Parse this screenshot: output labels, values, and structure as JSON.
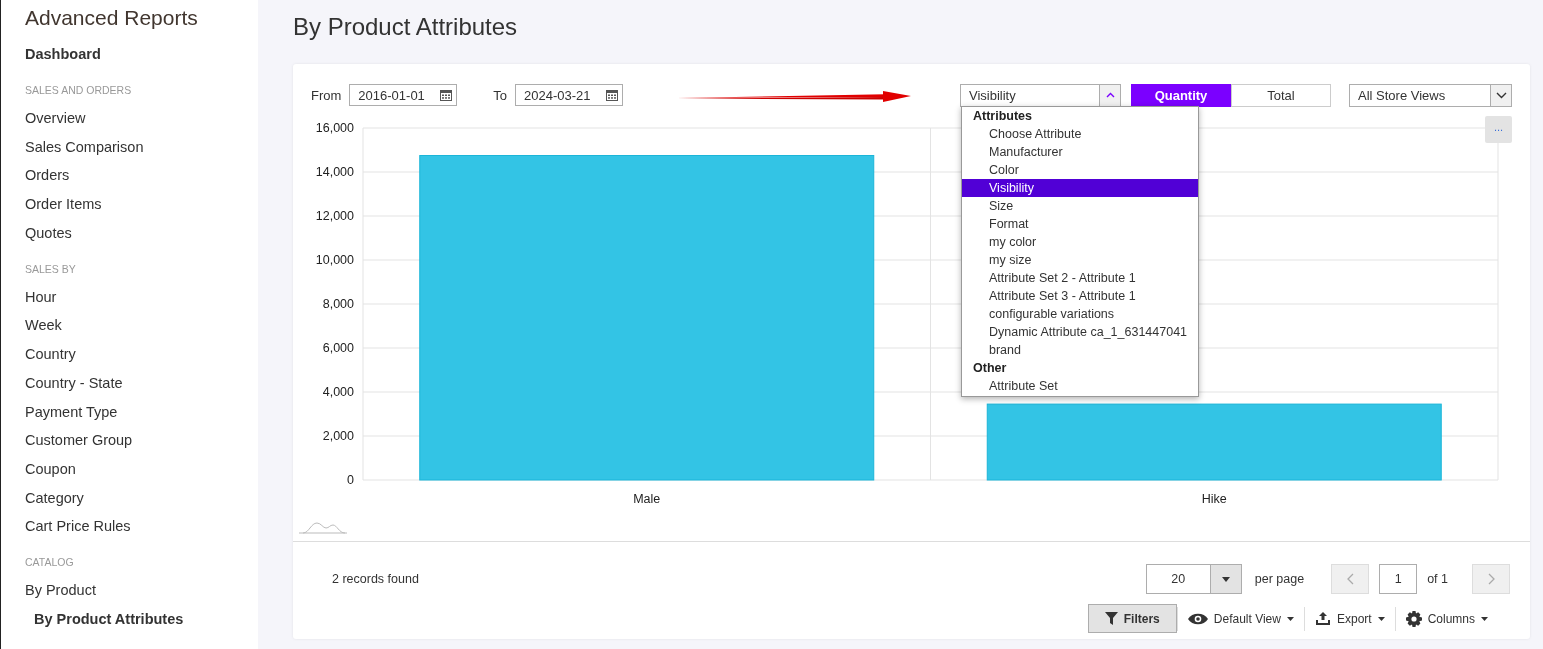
{
  "sidebar": {
    "title": "Advanced Reports",
    "dashboard": {
      "label": "Dashboard",
      "selected": false
    },
    "sections": [
      {
        "heading": "SALES AND ORDERS",
        "items": [
          {
            "label": "Overview",
            "selected": false
          },
          {
            "label": "Sales Comparison",
            "selected": false
          },
          {
            "label": "Orders",
            "selected": false
          },
          {
            "label": "Order Items",
            "selected": false
          },
          {
            "label": "Quotes",
            "selected": false
          }
        ]
      },
      {
        "heading": "SALES BY",
        "items": [
          {
            "label": "Hour",
            "selected": false
          },
          {
            "label": "Week",
            "selected": false
          },
          {
            "label": "Country",
            "selected": false
          },
          {
            "label": "Country - State",
            "selected": false
          },
          {
            "label": "Payment Type",
            "selected": false
          },
          {
            "label": "Customer Group",
            "selected": false
          },
          {
            "label": "Coupon",
            "selected": false
          },
          {
            "label": "Category",
            "selected": false
          },
          {
            "label": "Cart Price Rules",
            "selected": false
          }
        ]
      },
      {
        "heading": "CATALOG",
        "items": [
          {
            "label": "By Product",
            "selected": false,
            "children": [
              {
                "label": "By Product Attributes",
                "selected": true
              }
            ]
          }
        ]
      }
    ]
  },
  "page_title": "By Product Attributes",
  "toolbar": {
    "from_label": "From",
    "from_value": "2016-01-01",
    "to_label": "To",
    "to_value": "2024-03-21",
    "attribute_select": {
      "value": "Visibility",
      "expanded": true
    },
    "metric_toggle": [
      {
        "label": "Quantity",
        "selected": true
      },
      {
        "label": "Total",
        "selected": false
      }
    ],
    "store_select": {
      "value": "All Store Views"
    }
  },
  "attribute_dropdown": [
    {
      "group": "Attributes",
      "options": [
        {
          "label": "Choose Attribute",
          "selected": false
        },
        {
          "label": "Manufacturer",
          "selected": false
        },
        {
          "label": "Color",
          "selected": false
        },
        {
          "label": "Visibility",
          "selected": true
        },
        {
          "label": "Size",
          "selected": false
        },
        {
          "label": "Format",
          "selected": false
        },
        {
          "label": "my color",
          "selected": false
        },
        {
          "label": "my size",
          "selected": false
        },
        {
          "label": "Attribute Set 2 - Attribute 1",
          "selected": false
        },
        {
          "label": "Attribute Set 3 - Attribute 1",
          "selected": false
        },
        {
          "label": "configurable variations",
          "selected": false
        },
        {
          "label": "Dynamic Attribute ca_1_631447041",
          "selected": false
        },
        {
          "label": "brand",
          "selected": false
        }
      ]
    },
    {
      "group": "Other",
      "options": [
        {
          "label": "Attribute Set",
          "selected": false
        }
      ]
    }
  ],
  "chart_menu": "...",
  "chart_data": {
    "type": "bar",
    "grid": true,
    "categories": [
      "Male",
      "Hike"
    ],
    "values": [
      14750,
      3450
    ],
    "ylim": [
      0,
      16000
    ],
    "yticks": [
      {
        "value": 0,
        "label": "0"
      },
      {
        "value": 2000,
        "label": "2,000"
      },
      {
        "value": 4000,
        "label": "4,000"
      },
      {
        "value": 6000,
        "label": "6,000"
      },
      {
        "value": 8000,
        "label": "8,000"
      },
      {
        "value": 10000,
        "label": "10,000"
      },
      {
        "value": 12000,
        "label": "12,000"
      },
      {
        "value": 14000,
        "label": "14,000"
      },
      {
        "value": 16000,
        "label": "16,000"
      }
    ]
  },
  "footer": {
    "records": "2 records found",
    "page_size": "20",
    "per_page_label": "per page",
    "page": "1",
    "of_pages": "of 1",
    "actions": [
      {
        "kind": "filters",
        "label": "Filters"
      },
      {
        "kind": "view",
        "label": "Default View"
      },
      {
        "kind": "export",
        "label": "Export"
      },
      {
        "kind": "columns",
        "label": "Columns"
      }
    ]
  }
}
